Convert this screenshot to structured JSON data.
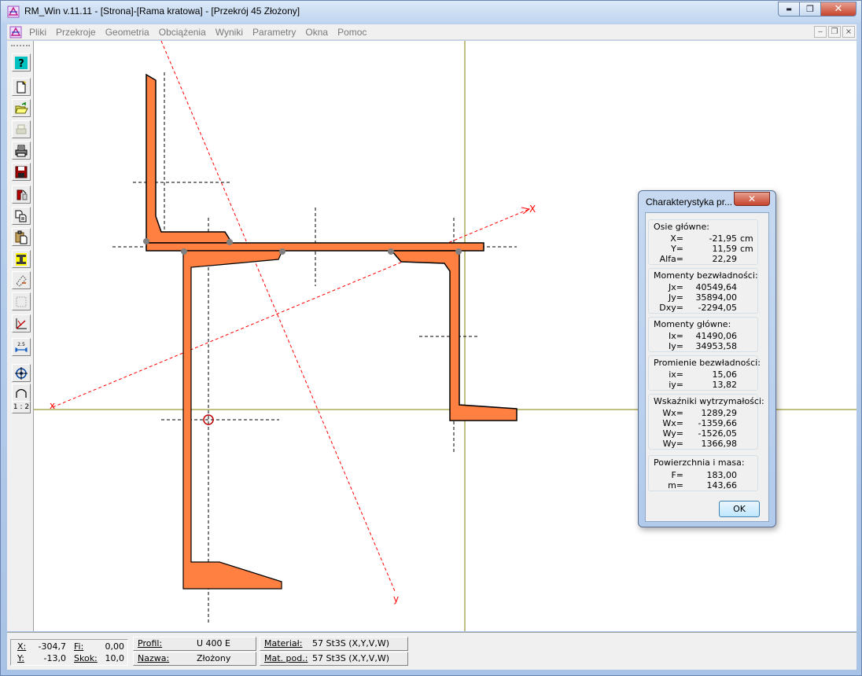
{
  "window": {
    "title": "RM_Win v.11.11 - [Strona]-[Rama kratowa] - [Przekrój  45  Złożony]",
    "minimize": "▬",
    "maximize": "❐",
    "close": "✕"
  },
  "menu": {
    "items": [
      "Pliki",
      "Przekroje",
      "Geometria",
      "Obciążenia",
      "Wyniki",
      "Parametry",
      "Okna",
      "Pomoc"
    ],
    "mdi_minimize": "‒",
    "mdi_restore": "❐",
    "mdi_close": "×"
  },
  "toolbar": {
    "help": "?",
    "scale_label": "2.5",
    "ratio_label": "1 : 2"
  },
  "canvas": {
    "axis_x_label": "X",
    "axis_x_neg_label": "x",
    "axis_y_label": "y",
    "colors": {
      "profile_fill": "#ff8040",
      "outline": "#000000",
      "principal_axis": "#ff0000",
      "global_axis": "#808000"
    }
  },
  "dialog": {
    "title": "Charakterystyka pr...",
    "close": "✕",
    "groups": [
      {
        "label": "Osie główne:",
        "rows": [
          {
            "k": "X=",
            "v": "-21,95",
            "u": "cm"
          },
          {
            "k": "Y=",
            "v": "11,59",
            "u": "cm"
          },
          {
            "k": "Alfa=",
            "v": "22,29",
            "u": ""
          }
        ]
      },
      {
        "label": "Momenty bezwładności:",
        "rows": [
          {
            "k": "Jx=",
            "v": "40549,64",
            "u": ""
          },
          {
            "k": "Jy=",
            "v": "35894,00",
            "u": ""
          },
          {
            "k": "Dxy=",
            "v": "-2294,05",
            "u": ""
          }
        ]
      },
      {
        "label": "Momenty główne:",
        "rows": [
          {
            "k": "Ix=",
            "v": "41490,06",
            "u": ""
          },
          {
            "k": "Iy=",
            "v": "34953,58",
            "u": ""
          }
        ]
      },
      {
        "label": "Promienie bezwładności:",
        "rows": [
          {
            "k": "ix=",
            "v": "15,06",
            "u": ""
          },
          {
            "k": "iy=",
            "v": "13,82",
            "u": ""
          }
        ]
      },
      {
        "label": "Wskaźniki wytrzymałości:",
        "rows": [
          {
            "k": "Wx=",
            "v": "1289,29",
            "u": ""
          },
          {
            "k": "Wx=",
            "v": "-1359,66",
            "u": ""
          },
          {
            "k": "Wy=",
            "v": "-1526,05",
            "u": ""
          },
          {
            "k": "Wy=",
            "v": "1366,98",
            "u": ""
          }
        ]
      },
      {
        "label": "Powierzchnia i masa:",
        "rows": [
          {
            "k": "F=",
            "v": "183,00",
            "u": ""
          },
          {
            "k": "m=",
            "v": "143,66",
            "u": ""
          }
        ]
      }
    ],
    "ok": "OK"
  },
  "status": {
    "x_label": "X:",
    "x_value": "-304,7",
    "y_label": "Y:",
    "y_value": "-13,0",
    "fi_label": "Fi:",
    "fi_value": "0,00",
    "skok_label": "Skok:",
    "skok_value": "10,0",
    "profil_label": "Profil:",
    "profil_value": "U 400 E",
    "nazwa_label": "Nazwa:",
    "nazwa_value": "Złożony",
    "material_label": "Materiał:",
    "material_value": "57 St3S (X,Y,V,W)",
    "matpod_label": "Mat. pod.:",
    "matpod_value": "57 St3S (X,Y,V,W)"
  }
}
